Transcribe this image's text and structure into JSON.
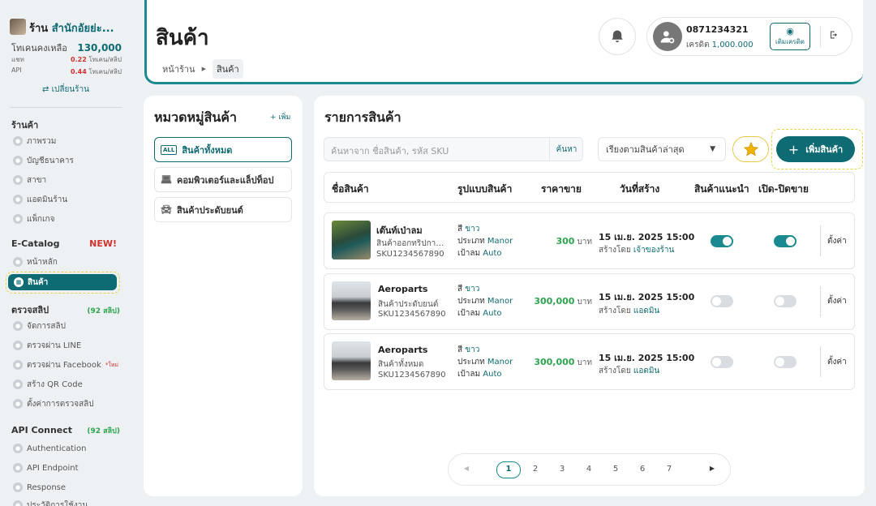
{
  "sidebar": {
    "shop_prefix": "ร้าน",
    "shop_name": "สำนักอัยย่ะ...",
    "token_label": "โทเคนคงเหลือ",
    "token_value": "130,000",
    "chat_label": "แชท",
    "chat_value": "0.22",
    "chat_unit": "โทเคน/สลิป",
    "api_label": "API",
    "api_value": "0.44",
    "api_unit": "โทเคน/สลิป",
    "switch_shop": "⇄ เปลี่ยนร้าน",
    "sections": {
      "shop": "ร้านค้า",
      "ecatalog": "E-Catalog",
      "ecatalog_badge": "NEW!",
      "verify": "ตรวจสลิป",
      "verify_count": "(92 สลิป)",
      "api": "API Connect",
      "api_count": "(92 สลิป)"
    },
    "shop_items": [
      "ภาพรวม",
      "บัญชีธนาคาร",
      "สาขา",
      "แอดมินร้าน",
      "แพ็กเกจ"
    ],
    "catalog_items": [
      "หน้าหลัก",
      "สินค้า"
    ],
    "verify_items": [
      "จัดการสลิป",
      "ตรวจผ่าน LINE",
      "ตรวจผ่าน Facebook",
      "สร้าง QR Code",
      "ตั้งค่าการตรวจสลิป"
    ],
    "facebook_new": "*ใหม่",
    "api_items": [
      "Authentication",
      "API Endpoint",
      "Response",
      "ประวัติการใช้งาน"
    ]
  },
  "header": {
    "title": "สินค้า",
    "breadcrumb": [
      "หน้าร้าน",
      "สินค้า"
    ],
    "phone": "0871234321",
    "credit_label": "เครดิต",
    "credit_value": "1,000.000",
    "topup": "เติมเครดิต"
  },
  "categories": {
    "title": "หมวดหมู่สินค้า",
    "add": "+ เพิ่ม",
    "all_badge": "ALL",
    "items": [
      "สินค้าทั้งหมด",
      "คอมพิวเตอร์และแล็ปท็อป",
      "สินค้าประดับยนต์"
    ]
  },
  "products": {
    "title": "รายการสินค้า",
    "search_placeholder": "ค้นหาจาก ชื่อสินค้า, รหัส SKU",
    "search_button": "ค้นหา",
    "sort_label": "เรียงตามสินค้าล่าสุด",
    "add_button": "เพิ่มสินค้า",
    "columns": [
      "ชื่อสินค้า",
      "รูปแบบสินค้า",
      "ราคาขาย",
      "วันที่สร้าง",
      "สินค้าแนะนำ",
      "เปิด-ปิดขาย"
    ],
    "labels": {
      "color": "สี",
      "type": "ประเภท",
      "tire": "เป้าลม",
      "baht": "บาท",
      "created_by": "สร้างโดย",
      "settings": "ตั้งค่า"
    },
    "rows": [
      {
        "name": "เต๊นท์เป่าลม",
        "category": "สินค้าออกทริปกางเต็นท์",
        "sku": "SKU1234567890",
        "color": "ขาว",
        "type": "Manor",
        "tire": "Auto",
        "price": "300",
        "date": "15 เม.ย. 2025 15:00",
        "creator": "เจ้าของร้าน",
        "recommended": true,
        "on_sale": true
      },
      {
        "name": "Aeroparts",
        "category": "สินค้าประดับยนต์",
        "sku": "SKU1234567890",
        "color": "ขาว",
        "type": "Manor",
        "tire": "Auto",
        "price": "300,000",
        "date": "15 เม.ย. 2025 15:00",
        "creator": "แอดมิน",
        "recommended": false,
        "on_sale": false
      },
      {
        "name": "Aeroparts",
        "category": "สินค้าทั้งหมด",
        "sku": "SKU1234567890",
        "color": "ขาว",
        "type": "Manor",
        "tire": "Auto",
        "price": "300,000",
        "date": "15 เม.ย. 2025 15:00",
        "creator": "แอดมิน",
        "recommended": false,
        "on_sale": false
      }
    ]
  },
  "pagination": {
    "pages": [
      "1",
      "2",
      "3",
      "4",
      "5",
      "6",
      "7"
    ],
    "current": "1"
  },
  "colors": {
    "primary": "#0f6b73",
    "accent": "#1a8a90",
    "price": "#2ea44f",
    "danger": "#d0312d",
    "highlight": "#e8d44a"
  }
}
